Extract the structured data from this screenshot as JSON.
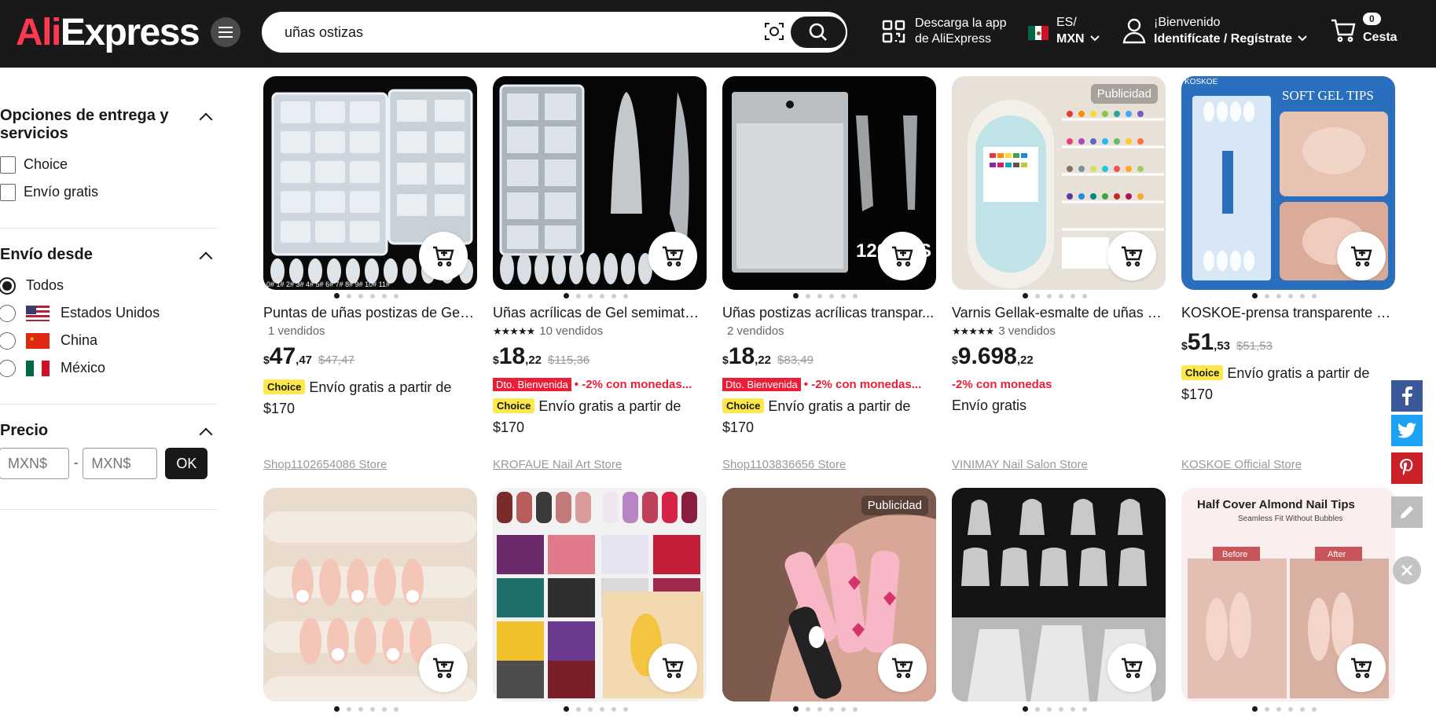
{
  "header": {
    "logo": {
      "ali": "Ali",
      "express": "Express"
    },
    "search_value": "uñas ostizas",
    "app_line1": "Descarga la app",
    "app_line2": "de AliExpress",
    "lang": "ES/",
    "currency": "MXN",
    "welcome": "¡Bienvenido",
    "signin": "Identifícate / Regístrate",
    "cart_count": "0",
    "cart_label": "Cesta"
  },
  "sidebar": {
    "delivery": {
      "title": "Opciones de entrega y servicios",
      "options": [
        "Choice",
        "Envío gratis"
      ]
    },
    "ship_from": {
      "title": "Envío desde",
      "options": [
        "Todos",
        "Estados Unidos",
        "China",
        "México"
      ],
      "selected": "Todos"
    },
    "price": {
      "title": "Precio",
      "min_placeholder": "MXN$",
      "sep": "-",
      "max_placeholder": "MXN$",
      "ok": "OK"
    }
  },
  "products": [
    {
      "title": "Puntas de uñas postizas de Gel ...",
      "sold": "1 vendidos",
      "stars": false,
      "currency": "$",
      "price_int": "47",
      "price_dec": ",47",
      "old": "$47,47",
      "tags": [],
      "ship": "Envío gratis a partir de $170",
      "choice": "Choice",
      "store": "Shop1102654086 Store",
      "ad": ""
    },
    {
      "title": "Uñas acrílicas de Gel semimate,...",
      "sold": "10 vendidos",
      "stars": true,
      "currency": "$",
      "price_int": "18",
      "price_dec": ",22",
      "old": "$115,36",
      "tags": [
        "Dto. Bienvenida",
        "• -2% con monedas..."
      ],
      "ship": "Envío gratis a partir de $170",
      "choice": "Choice",
      "store": "KROFAUE Nail Art Store",
      "ad": ""
    },
    {
      "title": "Uñas postizas acrílicas transpar...",
      "sold": "2 vendidos",
      "stars": false,
      "currency": "$",
      "price_int": "18",
      "price_dec": ",22",
      "old": "$83,49",
      "tags": [
        "Dto. Bienvenida",
        "• -2% con monedas..."
      ],
      "ship": "Envío gratis a partir de $170",
      "choice": "Choice",
      "store": "Shop1103836656 Store",
      "ad": ""
    },
    {
      "title": "Varnis Gellak-esmalte de uñas e...",
      "sold": "3 vendidos",
      "stars": true,
      "currency": "$",
      "price_int": "9.698",
      "price_dec": ",22",
      "old": "",
      "tags": [
        "-2% con monedas"
      ],
      "ship": "Envío gratis",
      "choice": "",
      "store": "VINIMAY Nail Salon Store",
      "ad": "Publicidad"
    },
    {
      "title": "KOSKOE-prensa transparente p...",
      "sold": "",
      "stars": false,
      "currency": "$",
      "price_int": "51",
      "price_dec": ",53",
      "old": "$51,53",
      "tags": [],
      "ship": "Envío gratis a partir de $170",
      "choice": "Choice",
      "store": "KOSKOE Official Store",
      "ad": ""
    }
  ],
  "row2_ads": [
    "",
    "",
    "Publicidad",
    "",
    ""
  ],
  "image_text": {
    "p3_count": "120 PCS",
    "p5_brand": "KOSKOE",
    "p5_headline": "SOFT GEL TIPS",
    "r2p5_title": "Half Cover Almond Nail Tips",
    "r2p5_sub": "Seamless Fit Without Bubbles",
    "r2p5_before": "Before",
    "r2p5_after": "After",
    "p1_size": "0# 1# 2# 3# 4# 5# 6# 7# 8# 9# 10# 11#"
  },
  "social": [
    "facebook-icon",
    "twitter-icon",
    "pinterest-icon",
    "edit-icon"
  ],
  "colors": {
    "header_bg": "#191919",
    "accent": "#fd384f",
    "choice_yellow": "#fde84c",
    "promo_red": "#ea1e36"
  }
}
